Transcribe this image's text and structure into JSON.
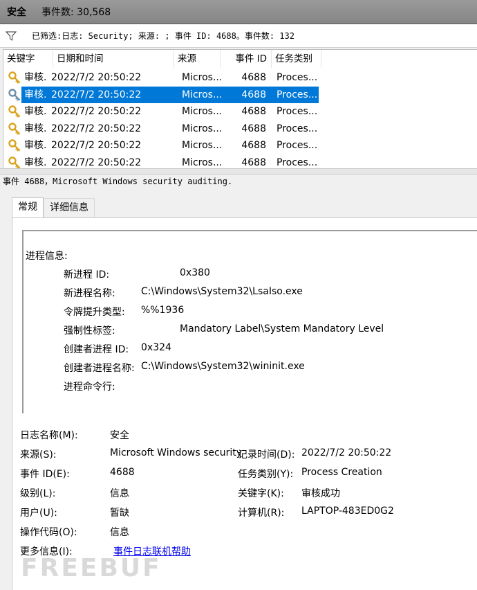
{
  "title": {
    "log": "安全",
    "count": "事件数: 30,568"
  },
  "filter": {
    "text": "已筛选:日志: Security; 来源: ; 事件 ID: 4688。事件数: 132"
  },
  "grid": {
    "columns": [
      "关键字",
      "日期和时间",
      "来源",
      "事件 ID",
      "任务类别"
    ],
    "rows": [
      {
        "keyword": "审核...",
        "date": "2022/7/2 20:50:22",
        "source": "Micros...",
        "id": "4688",
        "task": "Proces..."
      },
      {
        "keyword": "审核...",
        "date": "2022/7/2 20:50:22",
        "source": "Micros...",
        "id": "4688",
        "task": "Proces..."
      },
      {
        "keyword": "审核...",
        "date": "2022/7/2 20:50:22",
        "source": "Micros...",
        "id": "4688",
        "task": "Proces..."
      },
      {
        "keyword": "审核...",
        "date": "2022/7/2 20:50:22",
        "source": "Micros...",
        "id": "4688",
        "task": "Proces..."
      },
      {
        "keyword": "审核...",
        "date": "2022/7/2 20:50:22",
        "source": "Micros...",
        "id": "4688",
        "task": "Proces..."
      },
      {
        "keyword": "审核...",
        "date": "2022/7/2 20:50:22",
        "source": "Micros...",
        "id": "4688",
        "task": "Proces..."
      }
    ],
    "selected_row": 1,
    "selection_color": "#0078d7"
  },
  "event_header": "事件 4688，Microsoft Windows security auditing.",
  "tabs": [
    "常规",
    "详细信息"
  ],
  "description": {
    "section": "进程信息:",
    "items": [
      {
        "label": "新进程 ID:",
        "value": "0x380"
      },
      {
        "label": "新进程名称:",
        "value": "C:\\Windows\\System32\\LsaIso.exe"
      },
      {
        "label": "令牌提升类型:",
        "value": "%%1936"
      },
      {
        "label": "强制性标签:",
        "value": "Mandatory Label\\System Mandatory Level"
      },
      {
        "label": "创建者进程 ID:",
        "value": "0x324"
      },
      {
        "label": "创建者进程名称:",
        "value": "C:\\Windows\\System32\\wininit.exe"
      },
      {
        "label": "进程命令行:",
        "value": ""
      }
    ]
  },
  "details": {
    "log_name_label": "日志名称(M):",
    "log_name": "安全",
    "source_label": "来源(S):",
    "source": "Microsoft Windows security",
    "logged_label": "记录时间(D):",
    "logged": "2022/7/2 20:50:22",
    "event_id_label": "事件 ID(E):",
    "event_id": "4688",
    "task_label": "任务类别(Y):",
    "task": "Process Creation",
    "level_label": "级别(L):",
    "level": "信息",
    "keywords_label": "关键字(K):",
    "keywords": "审核成功",
    "user_label": "用户(U):",
    "user": "暂缺",
    "computer_label": "计算机(R):",
    "computer": "LAPTOP-483ED0G2",
    "opcode_label": "操作代码(O):",
    "opcode": "信息",
    "more_info_label": "更多信息(I):",
    "more_info_link": "事件日志联机帮助"
  },
  "watermark": "FREEBUF",
  "icons": {
    "filter": "filter-icon",
    "row": "key-icon"
  }
}
